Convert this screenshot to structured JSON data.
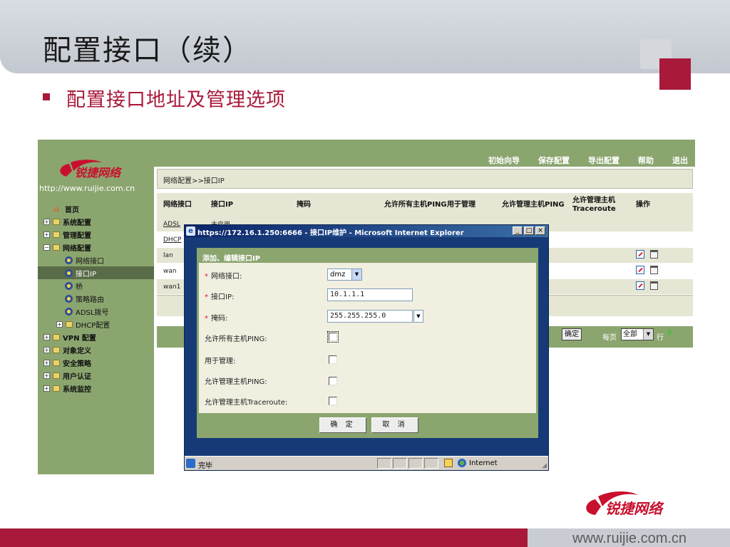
{
  "slide": {
    "title": "配置接口（续）",
    "subtitle": "配置接口地址及管理选项",
    "footer_url": "www.ruijie.com.cn",
    "brand_name": "锐捷网络",
    "colors": {
      "accent": "#a8193a",
      "panel_green": "#8ba56f",
      "header_gray": "#c9ccd2"
    }
  },
  "app": {
    "logo_text": "锐捷网络",
    "url": "http://www.ruijie.com.cn",
    "top_links": [
      "初始向导",
      "保存配置",
      "导出配置",
      "帮助",
      "退出"
    ],
    "breadcrumb": "网络配置>>接口IP",
    "sidebar": [
      {
        "label": "首页",
        "icon": "home-icon",
        "level": 0
      },
      {
        "label": "系统配置",
        "icon": "folder-icon",
        "level": 0
      },
      {
        "label": "管理配置",
        "icon": "folder-icon",
        "level": 0
      },
      {
        "label": "网络配置",
        "icon": "folder-icon",
        "level": 0
      },
      {
        "label": "网络接口",
        "icon": "gear-icon",
        "level": 1
      },
      {
        "label": "接口IP",
        "icon": "gear-icon",
        "level": 1,
        "active": true
      },
      {
        "label": "桥",
        "icon": "gear-icon",
        "level": 1
      },
      {
        "label": "策略路由",
        "icon": "gear-icon",
        "level": 1
      },
      {
        "label": "ADSL拨号",
        "icon": "gear-icon",
        "level": 1
      },
      {
        "label": "DHCP配置",
        "icon": "folder-icon",
        "level": 1
      },
      {
        "label": "VPN 配置",
        "icon": "folder-icon",
        "level": 0
      },
      {
        "label": "对象定义",
        "icon": "folder-icon",
        "level": 0
      },
      {
        "label": "安全策略",
        "icon": "folder-icon",
        "level": 0
      },
      {
        "label": "用户认证",
        "icon": "folder-icon",
        "level": 0
      },
      {
        "label": "系统监控",
        "icon": "folder-icon",
        "level": 0
      }
    ],
    "table": {
      "columns": [
        "网络接口",
        "接口IP",
        "掩码",
        "允许所有主机PING",
        "用于管理",
        "允许管理主机PING",
        "允许管理主机Traceroute",
        "操作"
      ],
      "rows": [
        {
          "iface": "ADSL",
          "ip": "未启用",
          "mask": "",
          "check": false,
          "actions": false,
          "link": true
        },
        {
          "iface": "DHCP",
          "ip": "",
          "mask": "",
          "check": false,
          "actions": false,
          "link": true
        },
        {
          "iface": "lan",
          "ip": "",
          "mask": "",
          "check": true,
          "actions": true,
          "link": false
        },
        {
          "iface": "wan",
          "ip": "",
          "mask": "",
          "check": true,
          "actions": true,
          "link": false
        },
        {
          "iface": "wan1",
          "ip": "",
          "mask": "",
          "check": true,
          "actions": true,
          "link": false
        }
      ]
    },
    "pager": {
      "ok_label": "确定",
      "per_page_label": "每页",
      "per_page_value": "全部",
      "rows_label": "行"
    }
  },
  "ie_window": {
    "title": "https://172.16.1.250:6666 - 接口IP维护 - Microsoft Internet Explorer",
    "status_text": "完毕",
    "zone": "Internet",
    "dialog": {
      "heading": "添加、编辑接口IP",
      "fields": {
        "iface_label": "网络接口:",
        "iface_value": "dmz",
        "ip_label": "接口IP:",
        "ip_value": "10.1.1.1",
        "mask_label": "掩码:",
        "mask_value": "255.255.255.0",
        "ping_all_label": "允许所有主机PING:",
        "manage_label": "用于管理:",
        "manage_ping_label": "允许管理主机PING:",
        "manage_trace_label": "允许管理主机Traceroute:"
      },
      "ok_label": "确 定",
      "cancel_label": "取 消"
    }
  }
}
